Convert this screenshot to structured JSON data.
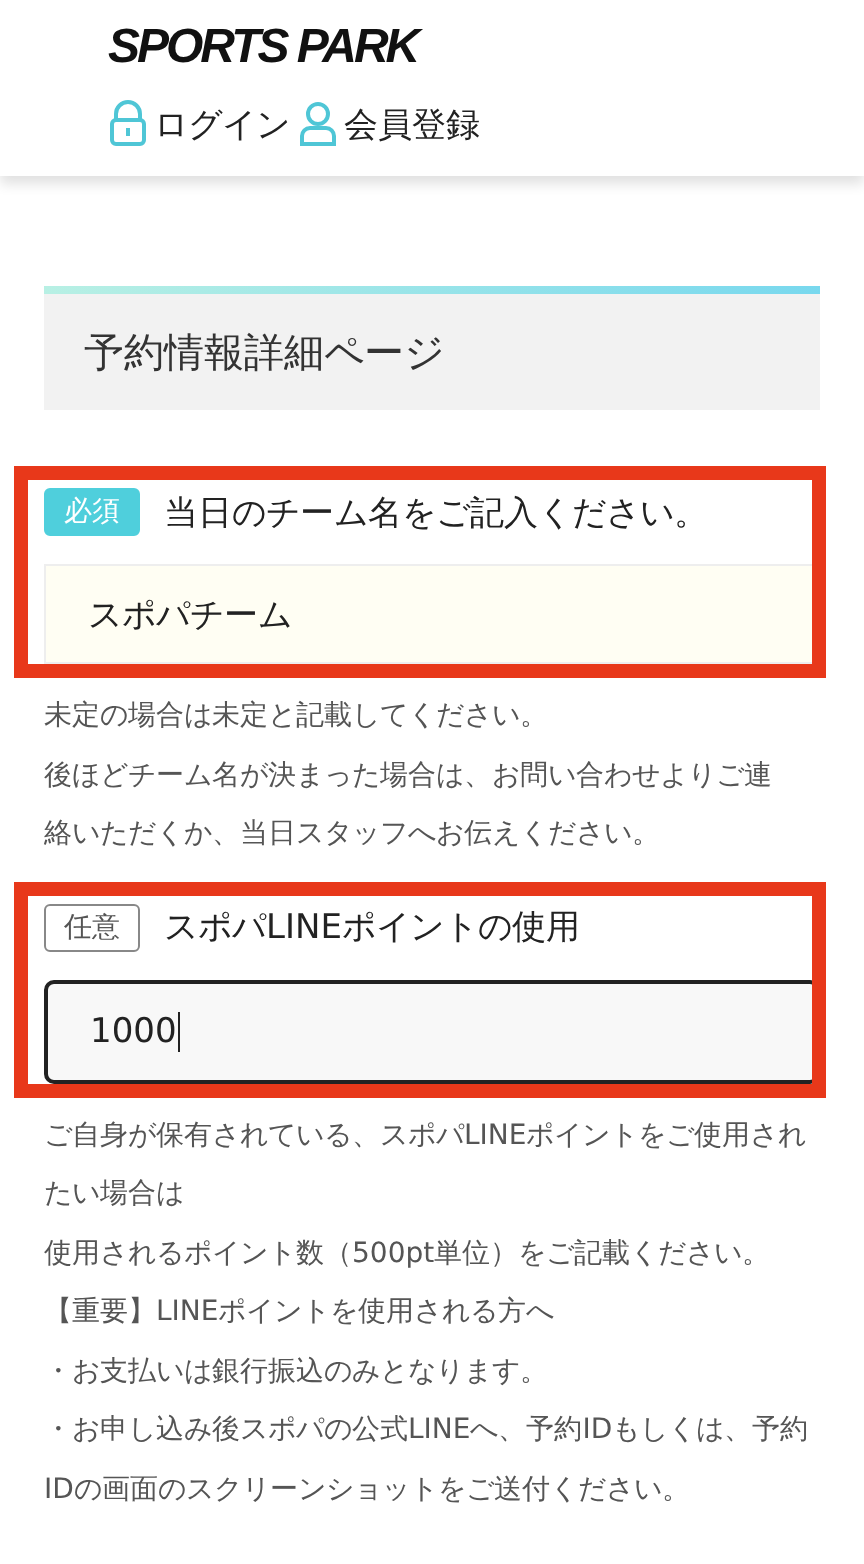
{
  "header": {
    "logo": "SPORTS PARK",
    "nav": [
      {
        "kind": "lock",
        "label": "ログイン"
      },
      {
        "kind": "person",
        "label": "会員登録"
      }
    ]
  },
  "page_title": "予約情報詳細ページ",
  "fields": [
    {
      "badge": "必須",
      "required": true,
      "label": "当日のチーム名をご記入ください。",
      "value": "スポパチーム",
      "focused": false,
      "highlighted": true,
      "notes": [
        "未定の場合は未定と記載してください。",
        "後ほどチーム名が決まった場合は、お問い合わせよりご連",
        "絡いただくか、当日スタッフへお伝えください。"
      ]
    },
    {
      "badge": "任意",
      "required": false,
      "label": "スポパLINEポイントの使用",
      "value": "1000",
      "focused": true,
      "highlighted": true,
      "notes": [
        "ご自身が保有されている、スポパLINEポイントをご使用され",
        "たい場合は",
        "使用されるポイント数（500pt単位）をご記載ください。",
        "【重要】LINEポイントを使用される方へ",
        "・お支払いは銀行振込のみとなります。",
        "・お申し込み後スポパの公式LINEへ、予約IDもしくは、予約",
        "IDの画面のスクリーンショットをご送付ください。"
      ]
    }
  ]
}
